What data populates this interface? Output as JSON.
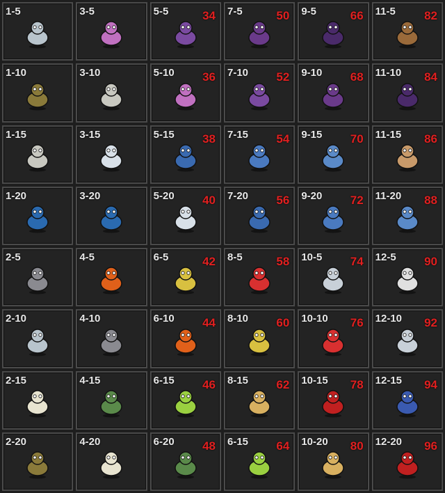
{
  "cells": [
    {
      "stage": "1-5",
      "num": "",
      "icon": "elephant-icon",
      "color": "#b8c4cc"
    },
    {
      "stage": "3-5",
      "num": "",
      "icon": "jester-icon",
      "color": "#c070c0"
    },
    {
      "stage": "5-5",
      "num": "34",
      "icon": "reaper-icon",
      "color": "#7a4aa0"
    },
    {
      "stage": "7-5",
      "num": "50",
      "icon": "bat-icon",
      "color": "#6a3a8a"
    },
    {
      "stage": "9-5",
      "num": "66",
      "icon": "crow-icon",
      "color": "#4a2a6a"
    },
    {
      "stage": "11-5",
      "num": "82",
      "icon": "cow-icon",
      "color": "#9a6a3a"
    },
    {
      "stage": "1-10",
      "num": "",
      "icon": "tree-stump-icon",
      "color": "#8a7a3a"
    },
    {
      "stage": "3-10",
      "num": "",
      "icon": "mummy-icon",
      "color": "#c8c8c0"
    },
    {
      "stage": "5-10",
      "num": "36",
      "icon": "jester-icon",
      "color": "#c070c0"
    },
    {
      "stage": "7-10",
      "num": "52",
      "icon": "reaper-icon",
      "color": "#7a4aa0"
    },
    {
      "stage": "9-10",
      "num": "68",
      "icon": "bat-icon",
      "color": "#6a3a8a"
    },
    {
      "stage": "11-10",
      "num": "84",
      "icon": "crow-icon",
      "color": "#4a2a6a"
    },
    {
      "stage": "1-15",
      "num": "",
      "icon": "mummy-icon",
      "color": "#c8c8c0"
    },
    {
      "stage": "3-15",
      "num": "",
      "icon": "snowman-icon",
      "color": "#d8e0e8"
    },
    {
      "stage": "5-15",
      "num": "38",
      "icon": "wolf-icon",
      "color": "#3a6ab0"
    },
    {
      "stage": "7-15",
      "num": "54",
      "icon": "totem-icon",
      "color": "#4a7ac0"
    },
    {
      "stage": "9-15",
      "num": "70",
      "icon": "frog-icon",
      "color": "#5a8ac8"
    },
    {
      "stage": "11-15",
      "num": "86",
      "icon": "girl-icon",
      "color": "#c89a6a"
    },
    {
      "stage": "1-20",
      "num": "",
      "icon": "blue-beast-icon",
      "color": "#2a6ab0"
    },
    {
      "stage": "3-20",
      "num": "",
      "icon": "blue-beast-icon",
      "color": "#2a6ab0"
    },
    {
      "stage": "5-20",
      "num": "40",
      "icon": "snowman-icon",
      "color": "#d8e0e8"
    },
    {
      "stage": "7-20",
      "num": "56",
      "icon": "wolf-icon",
      "color": "#3a6ab0"
    },
    {
      "stage": "9-20",
      "num": "72",
      "icon": "totem-icon",
      "color": "#4a7ac0"
    },
    {
      "stage": "11-20",
      "num": "88",
      "icon": "frog-icon",
      "color": "#5a8ac8"
    },
    {
      "stage": "2-5",
      "num": "",
      "icon": "cannon-icon",
      "color": "#8a8a90"
    },
    {
      "stage": "4-5",
      "num": "",
      "icon": "phoenix-icon",
      "color": "#e0601a"
    },
    {
      "stage": "6-5",
      "num": "42",
      "icon": "genie-icon",
      "color": "#d8c040"
    },
    {
      "stage": "8-5",
      "num": "58",
      "icon": "nurse-icon",
      "color": "#d83030"
    },
    {
      "stage": "10-5",
      "num": "74",
      "icon": "wolf-icon",
      "color": "#c8d0d8"
    },
    {
      "stage": "12-5",
      "num": "90",
      "icon": "cloud-icon",
      "color": "#e0e0e0"
    },
    {
      "stage": "2-10",
      "num": "",
      "icon": "elephant-icon",
      "color": "#b8c4cc"
    },
    {
      "stage": "4-10",
      "num": "",
      "icon": "cannon-icon",
      "color": "#8a8a90"
    },
    {
      "stage": "6-10",
      "num": "44",
      "icon": "phoenix-icon",
      "color": "#e0601a"
    },
    {
      "stage": "8-10",
      "num": "60",
      "icon": "genie-icon",
      "color": "#d8c040"
    },
    {
      "stage": "10-10",
      "num": "76",
      "icon": "nurse-icon",
      "color": "#d83030"
    },
    {
      "stage": "12-10",
      "num": "92",
      "icon": "wolf-icon",
      "color": "#c8d0d8"
    },
    {
      "stage": "2-15",
      "num": "",
      "icon": "unicorn-icon",
      "color": "#e8e4d0"
    },
    {
      "stage": "4-15",
      "num": "",
      "icon": "chief-icon",
      "color": "#5a8a4a"
    },
    {
      "stage": "6-15",
      "num": "46",
      "icon": "fairy-icon",
      "color": "#9ad040"
    },
    {
      "stage": "8-15",
      "num": "62",
      "icon": "bear-icon",
      "color": "#d8b060"
    },
    {
      "stage": "10-15",
      "num": "78",
      "icon": "spider-icon",
      "color": "#c02020"
    },
    {
      "stage": "12-15",
      "num": "94",
      "icon": "wizard-icon",
      "color": "#3a5ab0"
    },
    {
      "stage": "2-20",
      "num": "",
      "icon": "tree-stump-icon",
      "color": "#8a7a3a"
    },
    {
      "stage": "4-20",
      "num": "",
      "icon": "unicorn-icon",
      "color": "#e8e4d0"
    },
    {
      "stage": "6-20",
      "num": "48",
      "icon": "chief-icon",
      "color": "#5a8a4a"
    },
    {
      "stage": "6-15",
      "num": "64",
      "icon": "fairy-icon",
      "color": "#9ad040"
    },
    {
      "stage": "10-20",
      "num": "80",
      "icon": "bear-icon",
      "color": "#d8b060"
    },
    {
      "stage": "12-20",
      "num": "96",
      "icon": "spider-icon",
      "color": "#c02020"
    }
  ]
}
